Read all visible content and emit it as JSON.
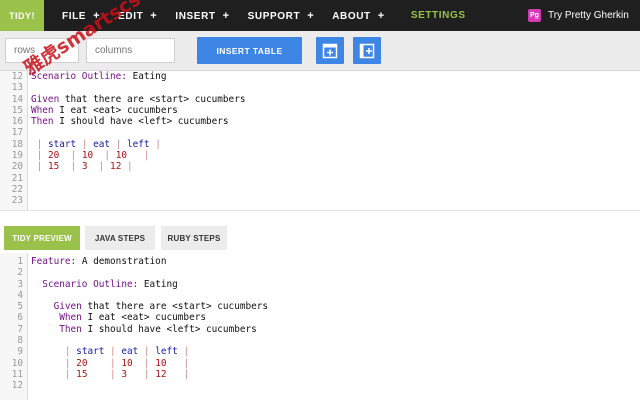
{
  "nav": {
    "brand": "TIDY!",
    "menu": [
      {
        "label": "FILE",
        "plus": "+"
      },
      {
        "label": "EDIT",
        "plus": "+"
      },
      {
        "label": "INSERT",
        "plus": "+"
      },
      {
        "label": "SUPPORT",
        "plus": "+"
      },
      {
        "label": "ABOUT",
        "plus": "+"
      }
    ],
    "settings": "SETTINGS",
    "promo_logo": "Pg",
    "promo": "Try Pretty Gherkin"
  },
  "toolbar": {
    "rows_placeholder": "rows",
    "cols_placeholder": "columns",
    "insert_table": "INSERT TABLE"
  },
  "editor": {
    "lines": [
      {
        "n": "12",
        "parts": [
          [
            "kw",
            "Scenario Outline: "
          ],
          [
            "pl",
            "Eating"
          ]
        ]
      },
      {
        "n": "13",
        "parts": []
      },
      {
        "n": "14",
        "parts": [
          [
            "kw",
            "Given "
          ],
          [
            "pl",
            "that there are <start> cucumbers"
          ]
        ]
      },
      {
        "n": "15",
        "parts": [
          [
            "kw",
            "When "
          ],
          [
            "pl",
            "I eat <eat> cucumbers"
          ]
        ]
      },
      {
        "n": "16",
        "parts": [
          [
            "kw",
            "Then "
          ],
          [
            "pl",
            "I should have <left> cucumbers"
          ]
        ]
      },
      {
        "n": "17",
        "parts": []
      },
      {
        "n": "18",
        "parts": [
          [
            "pipe",
            " | "
          ],
          [
            "hd",
            "start"
          ],
          [
            "pipe",
            " | "
          ],
          [
            "hd",
            "eat"
          ],
          [
            "pipe",
            " | "
          ],
          [
            "hd",
            "left"
          ],
          [
            "pipe",
            " |"
          ]
        ]
      },
      {
        "n": "19",
        "parts": [
          [
            "pipe",
            " | "
          ],
          [
            "num",
            "20"
          ],
          [
            "pipe",
            "  | "
          ],
          [
            "num",
            "10"
          ],
          [
            "pipe",
            "  | "
          ],
          [
            "num",
            "10"
          ],
          [
            "pipe",
            "   |"
          ]
        ]
      },
      {
        "n": "20",
        "parts": [
          [
            "pipe",
            " | "
          ],
          [
            "num",
            "15"
          ],
          [
            "pipe",
            "  | "
          ],
          [
            "num",
            "3"
          ],
          [
            "pipe",
            "  | "
          ],
          [
            "num",
            "12"
          ],
          [
            "pipe",
            " |"
          ]
        ]
      },
      {
        "n": "21",
        "parts": []
      },
      {
        "n": "22",
        "parts": []
      },
      {
        "n": "23",
        "parts": []
      }
    ]
  },
  "tabs": {
    "tidy_preview": "TIDY PREVIEW",
    "java_steps": "JAVA STEPS",
    "ruby_steps": "RUBY STEPS"
  },
  "preview": {
    "lines": [
      {
        "n": "1",
        "parts": [
          [
            "kw",
            "Feature: "
          ],
          [
            "pl",
            "A demonstration"
          ]
        ]
      },
      {
        "n": "2",
        "parts": []
      },
      {
        "n": "3",
        "parts": [
          [
            "pl",
            "  "
          ],
          [
            "kw",
            "Scenario Outline: "
          ],
          [
            "pl",
            "Eating"
          ]
        ]
      },
      {
        "n": "4",
        "parts": []
      },
      {
        "n": "5",
        "parts": [
          [
            "pl",
            "    "
          ],
          [
            "kw",
            "Given "
          ],
          [
            "pl",
            "that there are <start> cucumbers"
          ]
        ]
      },
      {
        "n": "6",
        "parts": [
          [
            "pl",
            "     "
          ],
          [
            "kw",
            "When "
          ],
          [
            "pl",
            "I eat <eat> cucumbers"
          ]
        ]
      },
      {
        "n": "7",
        "parts": [
          [
            "pl",
            "     "
          ],
          [
            "kw",
            "Then "
          ],
          [
            "pl",
            "I should have <left> cucumbers"
          ]
        ]
      },
      {
        "n": "8",
        "parts": []
      },
      {
        "n": "9",
        "parts": [
          [
            "pl",
            "      "
          ],
          [
            "pipe",
            "| "
          ],
          [
            "hd",
            "start"
          ],
          [
            "pipe",
            " | "
          ],
          [
            "hd",
            "eat"
          ],
          [
            "pipe",
            " | "
          ],
          [
            "hd",
            "left"
          ],
          [
            "pipe",
            " |"
          ]
        ]
      },
      {
        "n": "10",
        "parts": [
          [
            "pl",
            "      "
          ],
          [
            "pipe",
            "| "
          ],
          [
            "num",
            "20"
          ],
          [
            "pipe",
            "    | "
          ],
          [
            "num",
            "10"
          ],
          [
            "pipe",
            "  | "
          ],
          [
            "num",
            "10"
          ],
          [
            "pipe",
            "   |"
          ]
        ]
      },
      {
        "n": "11",
        "parts": [
          [
            "pl",
            "      "
          ],
          [
            "pipe",
            "| "
          ],
          [
            "num",
            "15"
          ],
          [
            "pipe",
            "    | "
          ],
          [
            "num",
            "3"
          ],
          [
            "pipe",
            "   | "
          ],
          [
            "num",
            "12"
          ],
          [
            "pipe",
            "   |"
          ]
        ]
      },
      {
        "n": "12",
        "parts": []
      }
    ]
  },
  "watermark": "雅虎smartscs66"
}
